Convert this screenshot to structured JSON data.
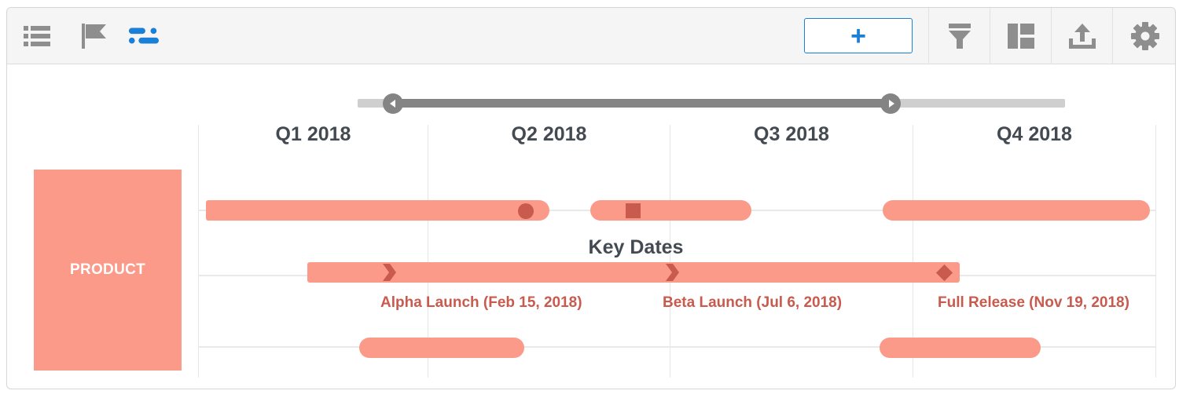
{
  "toolbar": {
    "view_icons": [
      "list-icon",
      "flag-icon",
      "timeline-icon"
    ],
    "add_label": "+",
    "right_icons": [
      "filter-icon",
      "layout-icon",
      "export-icon",
      "settings-icon"
    ]
  },
  "colors": {
    "accent": "#1a7fd6",
    "bar": "#fb9a89",
    "marker": "#c85a4e",
    "heading_text": "#444a52",
    "slider_track": "#cfcfcf",
    "slider_range": "#848484"
  },
  "timeline": {
    "quarters": [
      "Q1 2018",
      "Q2 2018",
      "Q3 2018",
      "Q4 2018"
    ],
    "lane_label": "PRODUCT",
    "key_dates_title": "Key Dates",
    "milestones": [
      {
        "label": "Alpha Launch (Feb 15, 2018)",
        "marker": "chevron"
      },
      {
        "label": "Beta Launch (Jul 6, 2018)",
        "marker": "chevron"
      },
      {
        "label": "Full Release (Nov 19, 2018)",
        "marker": "diamond"
      }
    ]
  }
}
